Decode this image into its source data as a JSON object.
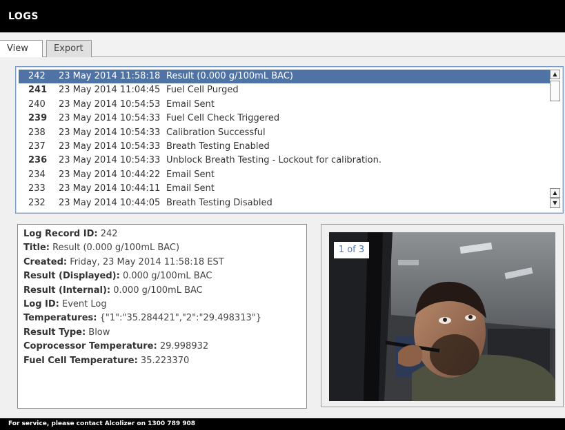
{
  "header": {
    "title": "LOGS"
  },
  "tabs": [
    {
      "label": "View",
      "active": true
    },
    {
      "label": "Export",
      "active": false
    }
  ],
  "log_list": {
    "rows": [
      {
        "id": "242",
        "date": "23 May 2014 11:58:18",
        "message": "Result (0.000 g/100mL BAC)",
        "selected": true,
        "bold": false
      },
      {
        "id": "241",
        "date": "23 May 2014 11:04:45",
        "message": "Fuel Cell Purged",
        "selected": false,
        "bold": true
      },
      {
        "id": "240",
        "date": "23 May 2014 10:54:53",
        "message": "Email Sent",
        "selected": false,
        "bold": false
      },
      {
        "id": "239",
        "date": "23 May 2014 10:54:33",
        "message": "Fuel Cell Check Triggered",
        "selected": false,
        "bold": true
      },
      {
        "id": "238",
        "date": "23 May 2014 10:54:33",
        "message": "Calibration Successful",
        "selected": false,
        "bold": false
      },
      {
        "id": "237",
        "date": "23 May 2014 10:54:33",
        "message": "Breath Testing Enabled",
        "selected": false,
        "bold": false
      },
      {
        "id": "236",
        "date": "23 May 2014 10:54:33",
        "message": "Unblock Breath Testing - Lockout for calibration.",
        "selected": false,
        "bold": true
      },
      {
        "id": "234",
        "date": "23 May 2014 10:44:22",
        "message": "Email Sent",
        "selected": false,
        "bold": false
      },
      {
        "id": "233",
        "date": "23 May 2014 10:44:11",
        "message": "Email Sent",
        "selected": false,
        "bold": false
      },
      {
        "id": "232",
        "date": "23 May 2014 10:44:05",
        "message": "Breath Testing Disabled",
        "selected": false,
        "bold": false
      }
    ],
    "selected_color": "#4f73a5"
  },
  "detail": [
    {
      "key": "Log Record ID:",
      "value": " 242"
    },
    {
      "key": "Title:",
      "value": " Result (0.000 g/100mL BAC)"
    },
    {
      "key": "Created:",
      "value": " Friday, 23 May 2014 11:58:18 EST"
    },
    {
      "key": "Result (Displayed):",
      "value": " 0.000 g/100mL BAC"
    },
    {
      "key": "Result (Internal):",
      "value": " 0.000 g/100mL BAC"
    },
    {
      "key": "Log ID:",
      "value": " Event Log"
    },
    {
      "key": "Temperatures:",
      "value": " {\"1\":\"35.284421\",\"2\":\"29.498313\"}"
    },
    {
      "key": "Result Type:",
      "value": " Blow"
    },
    {
      "key": "Coprocessor Temperature:",
      "value": " 29.998932"
    },
    {
      "key": "Fuel Cell Temperature:",
      "value": " 35.223370"
    }
  ],
  "photo": {
    "counter": "1 of 3",
    "icon": "webcam-photo"
  },
  "footer": {
    "text": "For service, please contact Alcolizer on 1300 789 908"
  },
  "icons": {
    "scroll_up": "arrow-up-icon",
    "scroll_down": "arrow-down-icon"
  }
}
